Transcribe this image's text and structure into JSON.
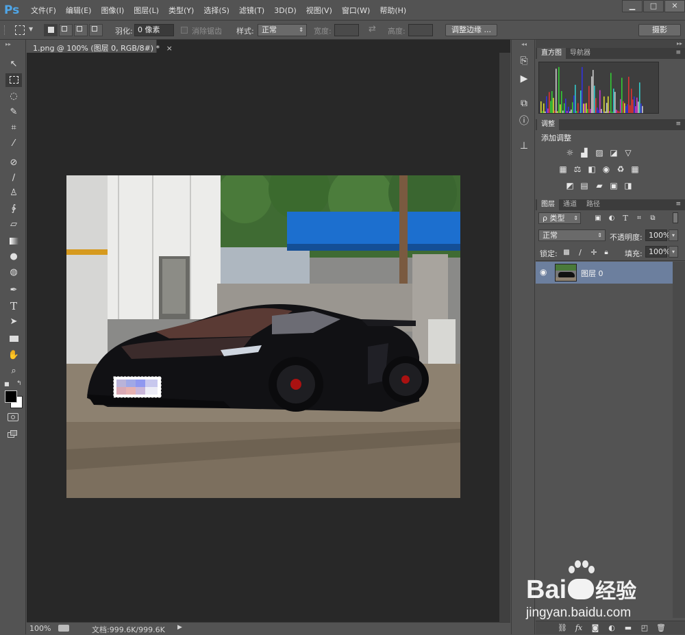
{
  "app": {
    "logo": "Ps"
  },
  "menu": [
    "文件(F)",
    "编辑(E)",
    "图像(I)",
    "图层(L)",
    "类型(Y)",
    "选择(S)",
    "滤镜(T)",
    "3D(D)",
    "视图(V)",
    "窗口(W)",
    "帮助(H)"
  ],
  "window_controls": {
    "minimize": "▁",
    "maximize": "□",
    "close": "✕"
  },
  "options": {
    "feather_label": "羽化:",
    "feather_value": "0 像素",
    "antialias_label": "消除锯齿",
    "style_label": "样式:",
    "style_value": "正常",
    "width_label": "宽度:",
    "swap_icon": "⇄",
    "height_label": "高度:",
    "refine_edge_button": "调整边缘 ...",
    "workspace_button": "摄影"
  },
  "document": {
    "tab_title": "1.png @ 100% (图层 0, RGB/8#) *",
    "tab_close": "×"
  },
  "status": {
    "zoom": "100%",
    "doc_info": "文档:999.6K/999.6K",
    "arrow": "▶"
  },
  "panels": {
    "histogram_tabs": [
      "直方图",
      "导航器"
    ],
    "adjustments_tab": "调整",
    "adjustments_title": "添加调整",
    "layers_tabs": [
      "图层",
      "通道",
      "路径"
    ],
    "kind_filter": "ρ 类型",
    "blend_mode": "正常",
    "opacity_label": "不透明度:",
    "opacity_value": "100%",
    "lock_label": "锁定:",
    "fill_label": "填充:",
    "fill_value": "100%",
    "layer_name": "图层 0"
  },
  "watermark": {
    "brand": "Bai",
    "brand2": "经验",
    "url": "jingyan.baidu.com"
  },
  "colors": {
    "ui_bg": "#535353",
    "doc_bg": "#282828",
    "accent": "#4fa6e8",
    "layer_selected": "#6c7f9e"
  }
}
